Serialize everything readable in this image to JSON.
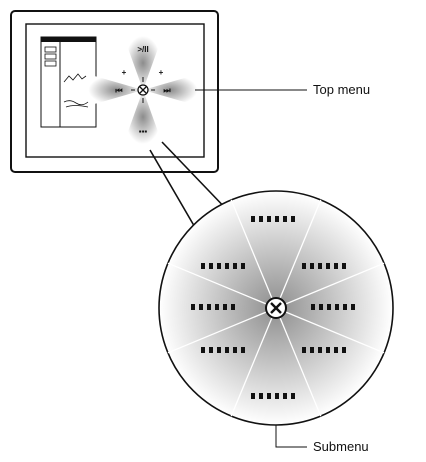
{
  "labels": {
    "top_menu": "Top menu",
    "submenu": "Submenu"
  },
  "top_menu_glyphs": {
    "top": ">/II",
    "left": "⏮",
    "right": "⏭",
    "bottom": "▪▪▪",
    "plus": "+"
  },
  "colors": {
    "outline": "#111111",
    "wedge_dark": "#9a9a9a",
    "wedge_light": "#ffffff"
  }
}
